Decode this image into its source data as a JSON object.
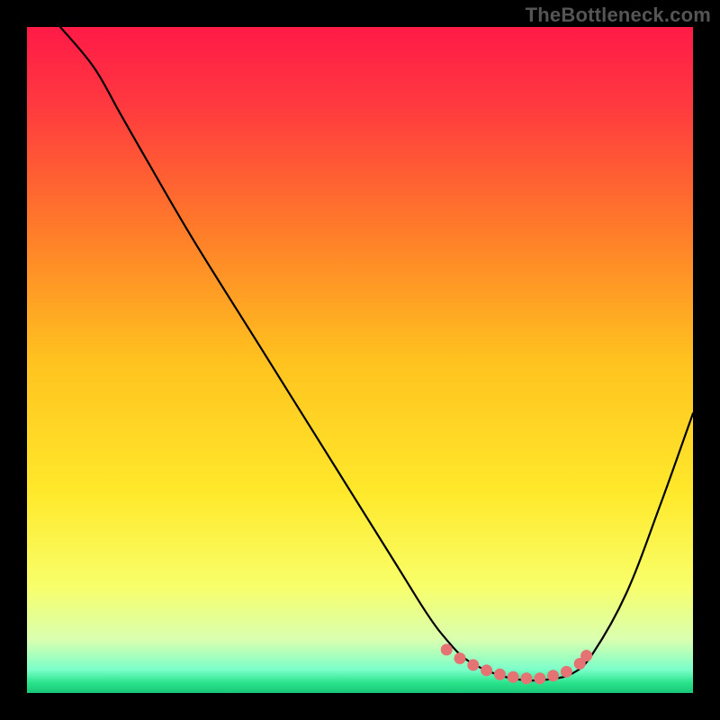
{
  "watermark": "TheBottleneck.com",
  "chart_data": {
    "type": "line",
    "title": "",
    "xlabel": "",
    "ylabel": "",
    "xlim": [
      0,
      100
    ],
    "ylim": [
      0,
      100
    ],
    "gradient_stops": [
      {
        "offset": 0,
        "color": "#ff1a47"
      },
      {
        "offset": 0.12,
        "color": "#ff3a3f"
      },
      {
        "offset": 0.3,
        "color": "#ff7a2a"
      },
      {
        "offset": 0.5,
        "color": "#ffc21f"
      },
      {
        "offset": 0.7,
        "color": "#ffe92b"
      },
      {
        "offset": 0.84,
        "color": "#f8ff6a"
      },
      {
        "offset": 0.92,
        "color": "#d9ffb0"
      },
      {
        "offset": 0.965,
        "color": "#7bffc9"
      },
      {
        "offset": 0.985,
        "color": "#29e38b"
      },
      {
        "offset": 1.0,
        "color": "#18c877"
      }
    ],
    "series": [
      {
        "name": "bottleneck-curve",
        "x": [
          5,
          10,
          14,
          18,
          25,
          35,
          45,
          55,
          60,
          63,
          66,
          70,
          74,
          78,
          82,
          85,
          90,
          95,
          100
        ],
        "y": [
          100,
          94,
          87,
          80,
          68,
          52,
          36,
          20,
          12,
          8,
          5,
          3,
          2,
          2,
          3,
          6,
          15,
          28,
          42
        ]
      }
    ],
    "markers": {
      "name": "sweet-spot",
      "color": "#e57373",
      "x": [
        63,
        65,
        67,
        69,
        71,
        73,
        75,
        77,
        79,
        81,
        83,
        84
      ],
      "y": [
        6.5,
        5.2,
        4.2,
        3.4,
        2.8,
        2.4,
        2.2,
        2.2,
        2.6,
        3.2,
        4.4,
        5.6
      ]
    }
  }
}
